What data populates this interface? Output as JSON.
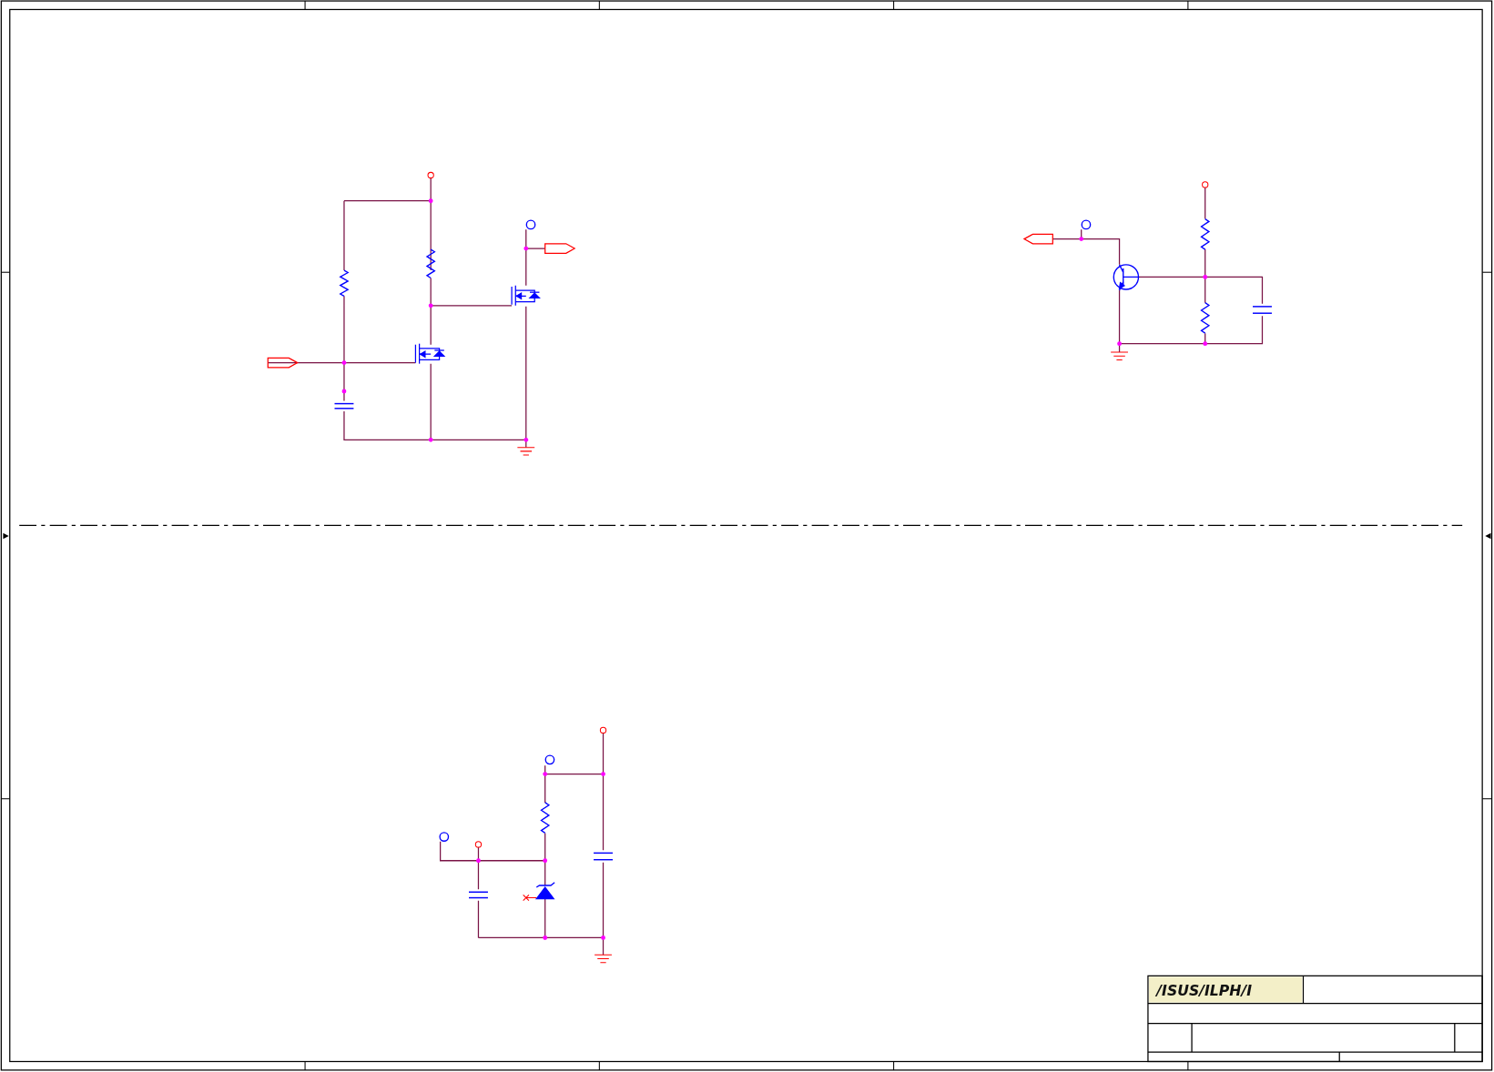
{
  "title_block": {
    "logo": "/ISUS/ILPH/I"
  }
}
